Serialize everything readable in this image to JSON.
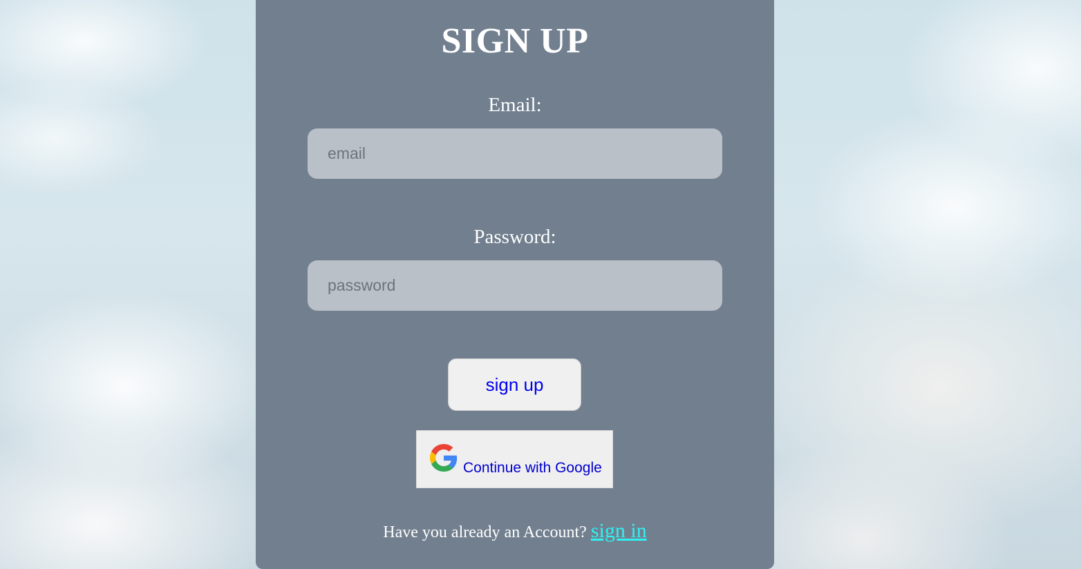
{
  "page": {
    "title": "SIGN UP"
  },
  "form": {
    "email_label": "Email:",
    "email_placeholder": "email",
    "email_value": "",
    "password_label": "Password:",
    "password_placeholder": "password",
    "password_value": "",
    "submit_label": "sign up"
  },
  "google": {
    "label": "Continue with Google",
    "icon": "google-g-icon"
  },
  "footer": {
    "prompt": "Have you already an Account?",
    "link_label": "sign in"
  },
  "colors": {
    "card_background": "#717f8f",
    "input_background": "#b9c0c8",
    "button_text": "#0000ee",
    "link": "#2ff3f3"
  }
}
